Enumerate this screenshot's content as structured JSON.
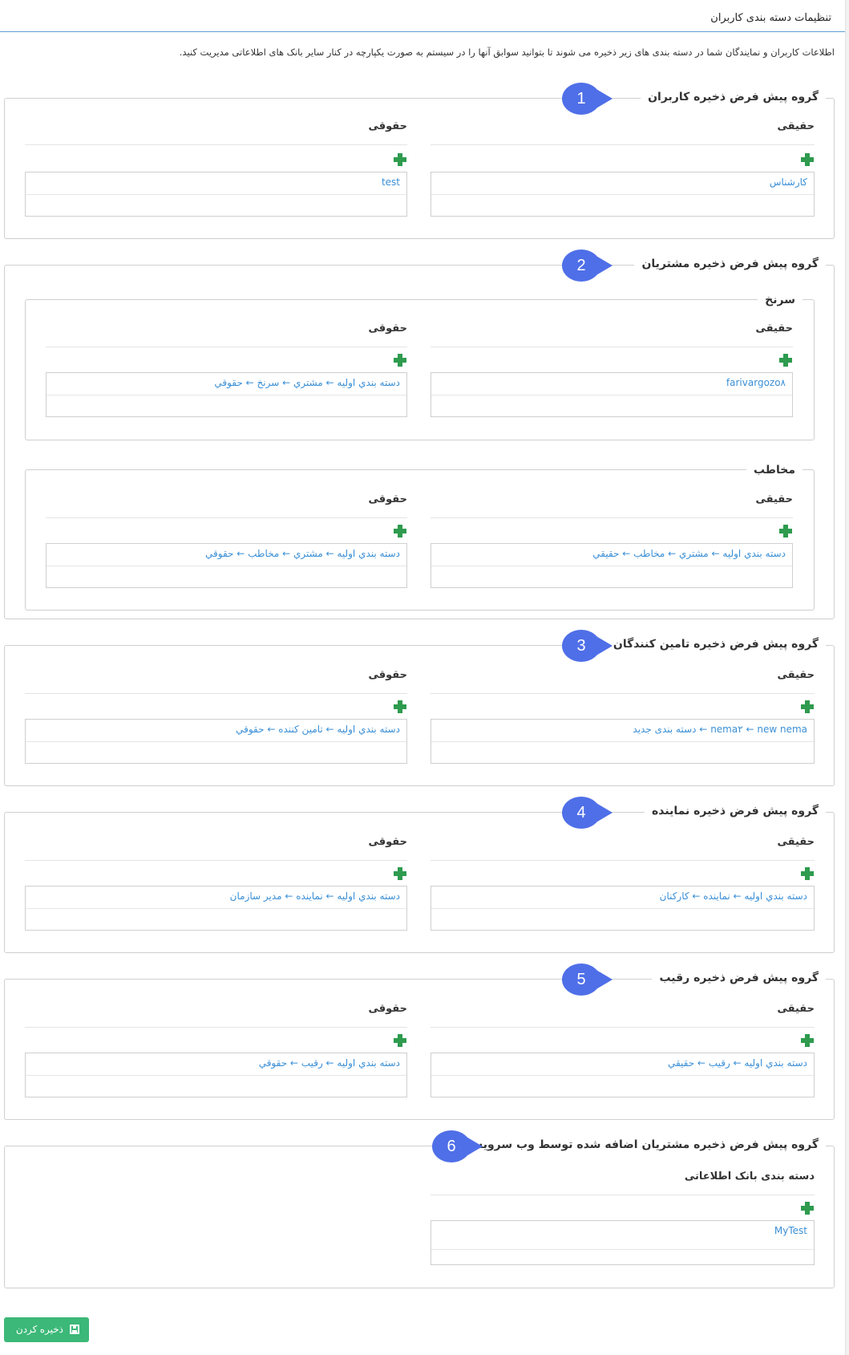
{
  "page": {
    "title": "تنظیمات دسته بندی کاربران",
    "intro": "اطلاعات کاربران و نمایندگان شما در دسته بندی های زیر ذخیره می شوند تا بتوانید سوابق آنها را در سیستم به صورت یکپارچه در کنار سایر بانک های اطلاعاتی مدیریت کنید."
  },
  "labels": {
    "real": "حقیقی",
    "legal": "حقوقی"
  },
  "groups": {
    "users": {
      "badge": "1",
      "legend": "گروه پیش فرض ذخیره کاربران",
      "real_value": "کارشناس",
      "legal_value": "test"
    },
    "customers": {
      "badge": "2",
      "legend": "گروه پیش فرض ذخیره مشتریان",
      "lead": {
        "legend": "سرنخ",
        "real_value": "farivargozo۸",
        "legal_value": "دسته بندي اوليه ← مشتري ← سرنخ ← حقوقي"
      },
      "contact": {
        "legend": "مخاطب",
        "real_value": "دسته بندي اوليه ← مشتري ← مخاطب ← حقيقي",
        "legal_value": "دسته بندي اوليه ← مشتري ← مخاطب ← حقوقي"
      }
    },
    "suppliers": {
      "badge": "3",
      "legend": "گروه پیش فرض ذخیره تامین کنندگان",
      "real_value": "nema۲ ← new nema ← دسته بندی جدید",
      "legal_value": "دسته بندي اوليه ← تامين كننده ← حقوقي"
    },
    "agents": {
      "badge": "4",
      "legend": "گروه پیش فرض ذخیره نماینده",
      "real_value": "دسته بندي اوليه ← نماینده ← کارکنان",
      "legal_value": "دسته بندي اوليه ← نماینده ← مدیر سازمان"
    },
    "competitors": {
      "badge": "5",
      "legend": "گروه پیش فرض ذخیره رقیب",
      "real_value": "دسته بندي اوليه ← رقيب ← حقيقي",
      "legal_value": "دسته بندي اوليه ← رقيب ← حقوقي"
    },
    "webservice": {
      "badge": "6",
      "legend": "گروه پیش فرض ذخیره مشتریان اضافه شده توسط وب سرویس",
      "column_title": "دسته بندی بانک اطلاعاتی",
      "value": "MyTest"
    }
  },
  "save_button": {
    "label": "ذخیره کردن"
  },
  "colors": {
    "badge": "#4f6fe8",
    "link_text": "#3a8fd6",
    "plus_icon": "#2e9b4e",
    "save_button": "#3cb878",
    "title_underline": "#5f9ed6"
  }
}
